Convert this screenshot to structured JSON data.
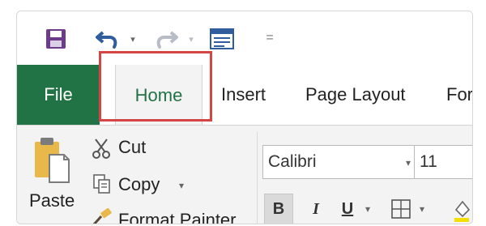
{
  "quick_access": {
    "save_icon": "save-icon",
    "undo_icon": "undo-icon",
    "redo_icon": "redo-icon",
    "form_icon": "form-icon",
    "customize_glyph": "="
  },
  "tabs": [
    {
      "label": "File"
    },
    {
      "label": "Home"
    },
    {
      "label": "Insert"
    },
    {
      "label": "Page Layout"
    },
    {
      "label": "For"
    }
  ],
  "clipboard": {
    "paste_label": "Paste",
    "cut_label": "Cut",
    "copy_label": "Copy",
    "format_painter_label": "Format Painter"
  },
  "font": {
    "family": "Calibri",
    "size": "11",
    "bold_label": "B",
    "italic_label": "I",
    "underline_label": "U"
  },
  "colors": {
    "file_tab_bg": "#217346",
    "home_tab_text": "#217346",
    "highlight_border": "#d64545",
    "ribbon_bg": "#f3f3f3"
  }
}
